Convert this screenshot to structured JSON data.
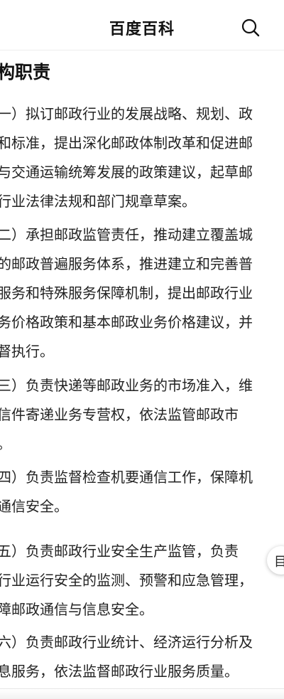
{
  "header": {
    "title": "百度百科"
  },
  "section": {
    "title": "构职责"
  },
  "paragraphs": [
    {
      "lines": [
        "一）拟订邮政行业的发展战略、规划、政",
        "和标准，提出深化邮政体制改革和促进邮",
        "与交通运输统筹发展的政策建议，起草邮",
        "行业法律法规和部门规章草案。"
      ]
    },
    {
      "lines": [
        "二）承担邮政监管责任，推动建立覆盖城",
        "的邮政普遍服务体系，推进建立和完善普",
        "服务和特殊服务保障机制，提出邮政行业",
        "务价格政策和基本邮政业务价格建议，并",
        "督执行。"
      ]
    },
    {
      "lines": [
        "三）负责快递等邮政业务的市场准入，维",
        "信件寄递业务专营权，依法监管邮政市",
        "。"
      ]
    },
    {
      "lines": [
        "四）负责监督检查机要通信工作，保障机",
        "通信安全。"
      ]
    },
    {
      "lines": [
        "五）负责邮政行业安全生产监管，负责",
        "行业运行安全的监测、预警和应急管理，",
        "障邮政通信与信息安全。"
      ]
    },
    {
      "lines": [
        "六）负责邮政行业统计、经济运行分析及",
        "息服务，依法监督邮政行业服务质量。"
      ]
    }
  ],
  "floating_button": {
    "label": "目"
  }
}
